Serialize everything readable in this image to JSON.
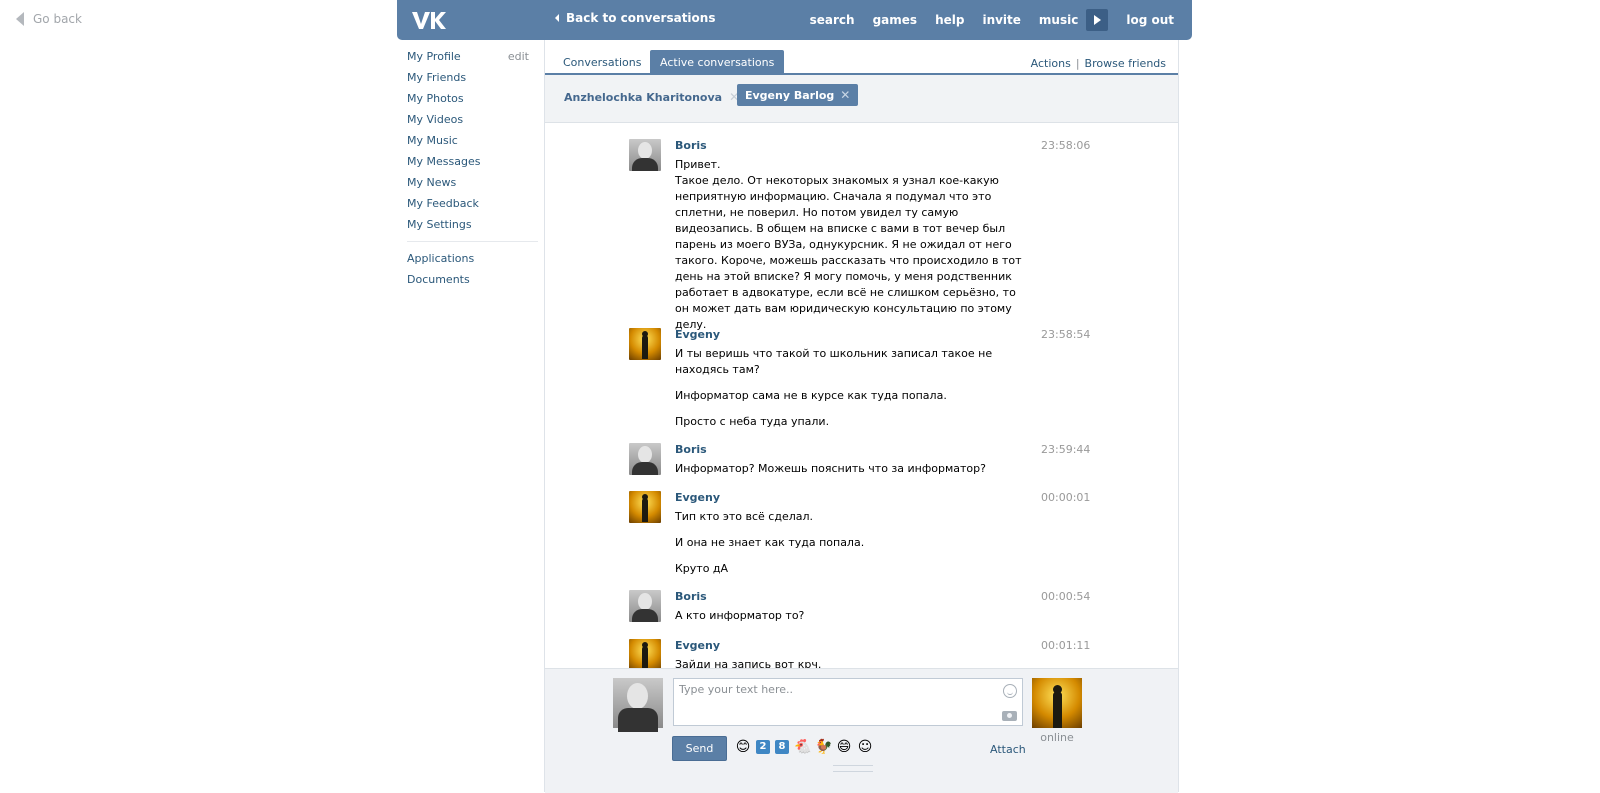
{
  "go_back": "Go back",
  "header": {
    "back_to_conversations": "Back to conversations",
    "nav": [
      "search",
      "games",
      "help",
      "invite",
      "music"
    ],
    "logout": "log out",
    "accent": "#5b7fa6"
  },
  "sidebar": {
    "items": [
      {
        "label": "My Profile",
        "extra": "edit"
      },
      {
        "label": "My Friends"
      },
      {
        "label": "My Photos"
      },
      {
        "label": "My Videos"
      },
      {
        "label": "My Music"
      },
      {
        "label": "My Messages"
      },
      {
        "label": "My News"
      },
      {
        "label": "My Feedback"
      },
      {
        "label": "My Settings"
      }
    ],
    "items2": [
      {
        "label": "Applications"
      },
      {
        "label": "Documents"
      }
    ]
  },
  "tabs": {
    "conversations": "Conversations",
    "active": "Active conversations",
    "actions": "Actions",
    "separator": "|",
    "browse": "Browse friends"
  },
  "peers": {
    "first": "Anzhelochka Kharitonova",
    "second": "Evgeny Barlog",
    "close": "✕"
  },
  "messages": [
    {
      "author": "Boris",
      "time": "23:58:06",
      "lines": [
        "Привет.\nТакое дело. От некоторых знакомых я узнал кое-какую неприятную информацию. Сначала я подумал что это сплетни, не поверил. Но потом увидел ту самую видеозапись. В общем на вписке с вами в тот вечер был парень из моего ВУЗа, однукурсник. Я не ожидал от него такого. Короче, можешь рассказать что происходило в тот день на этой вписке? Я могу помочь, у меня родственник работает в адвокатуре, если всё не слишком серьёзно, то он может дать вам юридическую консультацию по этому делу."
      ]
    },
    {
      "author": "Evgeny",
      "time": "23:58:54",
      "lines": [
        "И ты веришь что такой то школьник записал такое не находясь там?",
        "Информатор сама не в курсе как туда попала.",
        "Просто с неба туда упали."
      ]
    },
    {
      "author": "Boris",
      "time": "23:59:44",
      "lines": [
        "Информатор? Можешь пояснить что за информатор?"
      ]
    },
    {
      "author": "Evgeny",
      "time": "00:00:01",
      "lines": [
        "Тип кто это всё сделал.",
        "И она не знает как туда попала.",
        "Круто дА"
      ]
    },
    {
      "author": "Boris",
      "time": "00:00:54",
      "lines": [
        "А кто информатор то?"
      ]
    },
    {
      "author": "Evgeny",
      "time": "00:01:11",
      "lines": [
        "Зайди на запись вот крч."
      ]
    }
  ],
  "composer": {
    "placeholder": "Type your text here..",
    "send": "Send",
    "attach": "Attach",
    "online": "online",
    "emojis": [
      "😊",
      "2",
      "8",
      "🐔",
      "🐓",
      "😄",
      "☺"
    ]
  }
}
